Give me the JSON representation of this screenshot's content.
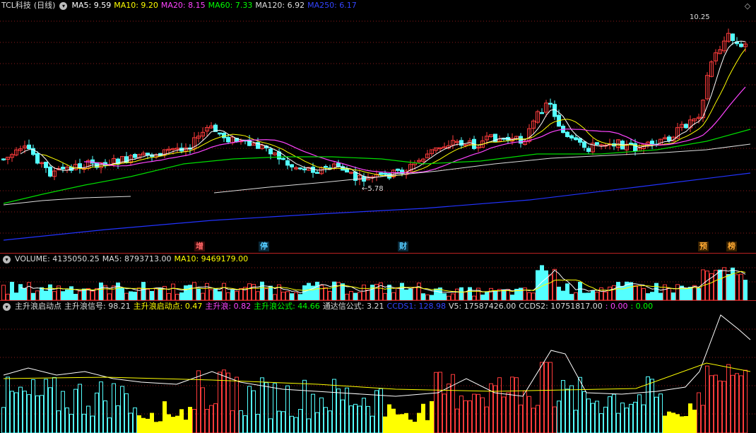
{
  "stock": {
    "name": "TCL科技",
    "period": "(日线)",
    "ma": [
      {
        "label": "MA5: 9.59",
        "color": "#ffffff"
      },
      {
        "label": "MA10: 9.20",
        "color": "#ffff00"
      },
      {
        "label": "MA20: 8.15",
        "color": "#ff44ff"
      },
      {
        "label": "MA60: 7.33",
        "color": "#00ff00"
      },
      {
        "label": "MA120: 6.92",
        "color": "#dddddd"
      },
      {
        "label": "MA250: 6.17",
        "color": "#3344ff"
      }
    ],
    "high_label": "10.25",
    "low_label": "←5.78",
    "tags": [
      {
        "text": "增",
        "color": "#ff6666",
        "bg": "#3a0a0a"
      },
      {
        "text": "停",
        "color": "#55ccff",
        "bg": "#0a2a3a"
      },
      {
        "text": "财",
        "color": "#55ccff",
        "bg": "#0a2a3a"
      },
      {
        "text": "预",
        "color": "#ffaa33",
        "bg": "#3a2200"
      },
      {
        "text": "榜",
        "color": "#ffaa33",
        "bg": "#3a2200"
      }
    ]
  },
  "volume": {
    "items": [
      {
        "label": "VOLUME: 4135050.25",
        "color": "#dddddd"
      },
      {
        "label": "MA5: 8793713.00",
        "color": "#dddddd"
      },
      {
        "label": "MA10: 9469179.00",
        "color": "#ffff00"
      }
    ]
  },
  "indicator": {
    "items": [
      {
        "label": "主升浪启动点",
        "color": "#dddddd"
      },
      {
        "label": "主升浪信号: 98.21",
        "color": "#dddddd"
      },
      {
        "label": "主升浪启动点: 0.47",
        "color": "#ffff00"
      },
      {
        "label": "主升浪: 0.82",
        "color": "#ff44ff"
      },
      {
        "label": "主升浪公式: 44.66",
        "color": "#00ff00"
      },
      {
        "label": "通达信公式: 3.21",
        "color": "#dddddd"
      },
      {
        "label": "CCDS1: 128.98",
        "color": "#3344ff"
      },
      {
        "label": "V5: 17587426.00",
        "color": "#dddddd"
      },
      {
        "label": "CCDS2: 10751817.00",
        "color": "#dddddd"
      },
      {
        "label": ": 0.00",
        "color": "#ff44ff"
      },
      {
        "label": ": 0.00",
        "color": "#00ff00"
      }
    ]
  },
  "colors": {
    "up": "#ff3b3b",
    "down": "#54ffff",
    "grid": "#8b1a1a",
    "yellow_bar": "#ffff00"
  },
  "icons": {
    "collapse": "chevron-circle-icon",
    "restore": "window-restore-icon"
  }
}
